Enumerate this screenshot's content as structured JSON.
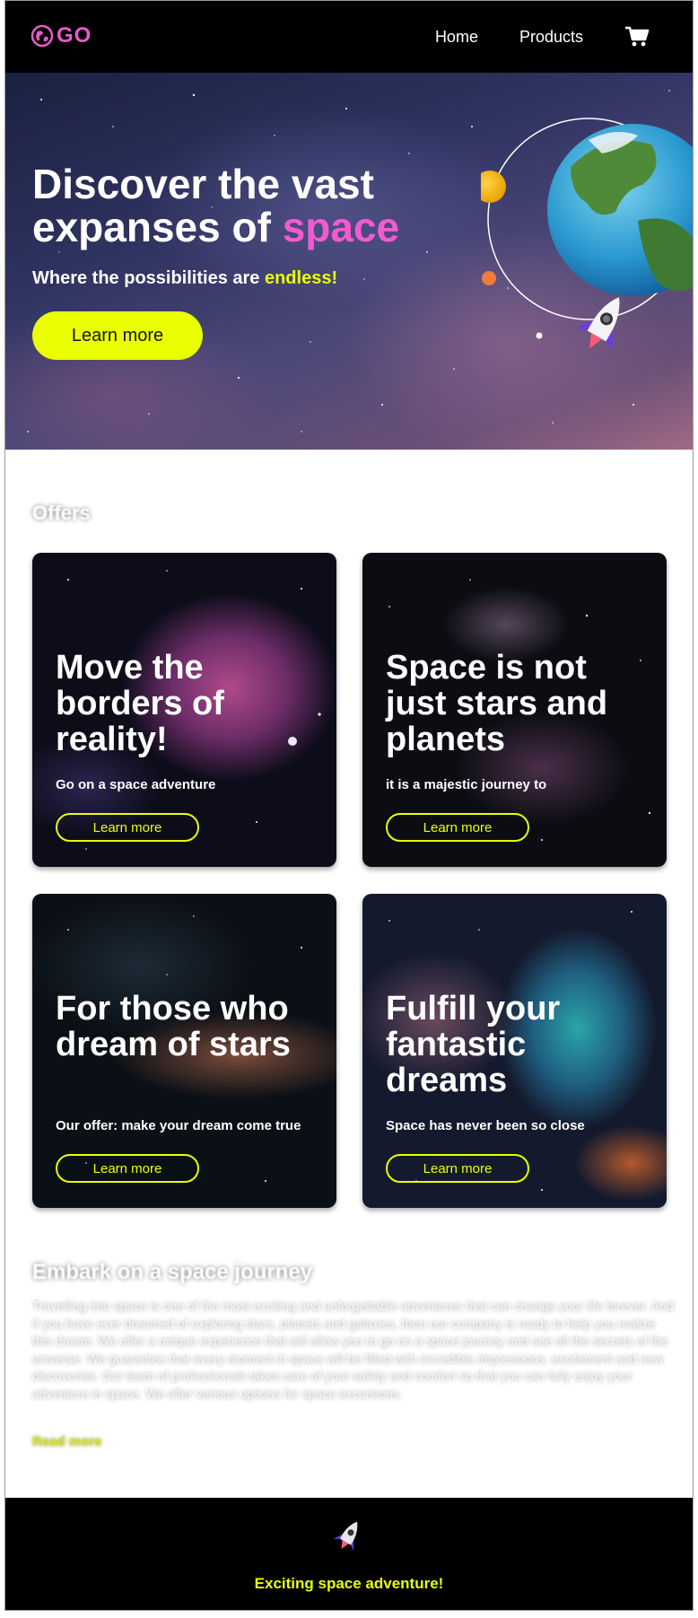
{
  "header": {
    "logo_text": "GO",
    "nav": [
      {
        "label": "Home"
      },
      {
        "label": "Products"
      }
    ],
    "cart_icon": "cart-icon"
  },
  "hero": {
    "title_part1": "Discover the vast expanses of ",
    "title_highlight": "space",
    "subtitle_part1": "Where the possibilities are ",
    "subtitle_highlight": "endless!",
    "button_label": "Learn more"
  },
  "offers": {
    "title": "Offers",
    "cards": [
      {
        "title": "Move the borders of reality!",
        "subtitle": "Go on a space adventure",
        "button_label": "Learn more"
      },
      {
        "title": "Space is not just stars and planets",
        "subtitle": "it is a majestic journey to",
        "button_label": "Learn more"
      },
      {
        "title": "For those who dream of stars",
        "subtitle": "Our offer: make your dream come true",
        "button_label": "Learn more"
      },
      {
        "title": "Fulfill your fantastic dreams",
        "subtitle": "Space has never been so close",
        "button_label": "Learn more"
      }
    ]
  },
  "journey": {
    "title": "Embark on a space journey",
    "text": "Travelling into space is one of the most exciting and unforgettable adventures that can change your life forever. And if you have ever dreamed of exploring stars, planets and galaxies, then our company is ready to help you realize this dream. We offer a unique experience that will allow you to go on a space journey and see all the secrets of the universe. We guarantee that every moment in space will be filled with incredible impressions, excitement and new discoveries. Our team of professionals takes care of your safety and comfort so that you can fully enjoy your adventure in space. We offer various options for space excursions.",
    "read_more": "Read more"
  },
  "footer": {
    "text": "Exciting space adventure!"
  },
  "colors": {
    "accent_yellow": "#eaff00",
    "accent_pink": "#f25bd0",
    "header_bg": "#000000"
  }
}
